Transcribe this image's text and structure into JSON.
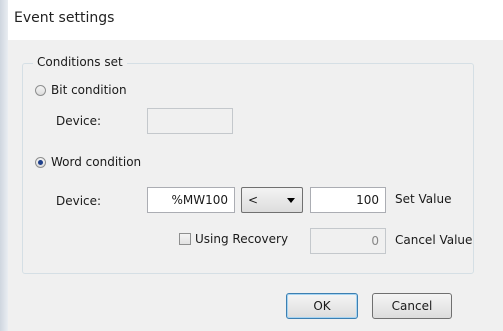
{
  "dialog": {
    "title": "Event settings",
    "group_title": "Conditions set"
  },
  "bit_condition": {
    "label": "Bit condition",
    "selected": false,
    "device_label": "Device:",
    "device_value": ""
  },
  "word_condition": {
    "label": "Word condition",
    "selected": true,
    "device_label": "Device:",
    "device_value": "%MW100",
    "operator": "<",
    "set_value": "100",
    "set_value_label": "Set Value"
  },
  "recovery": {
    "label": "Using Recovery",
    "checked": false,
    "cancel_value": "0",
    "cancel_value_label": "Cancel Value"
  },
  "buttons": {
    "ok": "OK",
    "cancel": "Cancel"
  }
}
